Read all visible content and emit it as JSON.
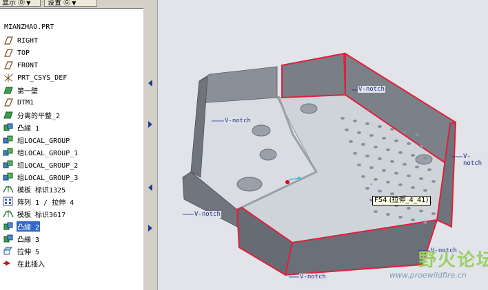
{
  "toolbar": {
    "show_label": "显示 Ⓓ",
    "settings_label": "设置 Ⓖ"
  },
  "tree": {
    "root": "MIANZHAO.PRT",
    "items": [
      {
        "label": "RIGHT",
        "icon": "datum-plane-icon"
      },
      {
        "label": "TOP",
        "icon": "datum-plane-icon"
      },
      {
        "label": "FRONT",
        "icon": "datum-plane-icon"
      },
      {
        "label": "PRT_CSYS_DEF",
        "icon": "coordinate-system-icon"
      },
      {
        "label": "第一壁",
        "icon": "sheetmetal-wall-icon"
      },
      {
        "label": "DTM1",
        "icon": "datum-plane-icon"
      },
      {
        "label": "分离的平整_2",
        "icon": "sheetmetal-wall-icon"
      },
      {
        "label": "凸緣 1",
        "icon": "flange-icon"
      },
      {
        "label": "组LOCAL_GROUP",
        "icon": "group-icon"
      },
      {
        "label": "组LOCAL_GROUP_1",
        "icon": "group-icon"
      },
      {
        "label": "组LOCAL_GROUP_2",
        "icon": "group-icon"
      },
      {
        "label": "组LOCAL_GROUP_3",
        "icon": "group-icon"
      },
      {
        "label": "模板 标识1325",
        "icon": "form-icon"
      },
      {
        "label": "阵列 1 / 拉伸 4",
        "icon": "pattern-icon"
      },
      {
        "label": "模板 标识3617",
        "icon": "form-icon"
      },
      {
        "label": "凸緣 2",
        "icon": "flange-icon",
        "selected": true
      },
      {
        "label": "凸緣 3",
        "icon": "flange-icon"
      },
      {
        "label": "拉伸 5",
        "icon": "extrude-icon"
      },
      {
        "label": "在此插入",
        "icon": "insert-here-arrow-icon"
      }
    ]
  },
  "viewport": {
    "vnotch_label": "V-notch",
    "tooltip": "F54 (拉伸_4_41)",
    "edge_highlight_color": "#e0203a"
  },
  "watermark": {
    "title": "野火论坛",
    "url": "www.proewildfire.cn"
  }
}
